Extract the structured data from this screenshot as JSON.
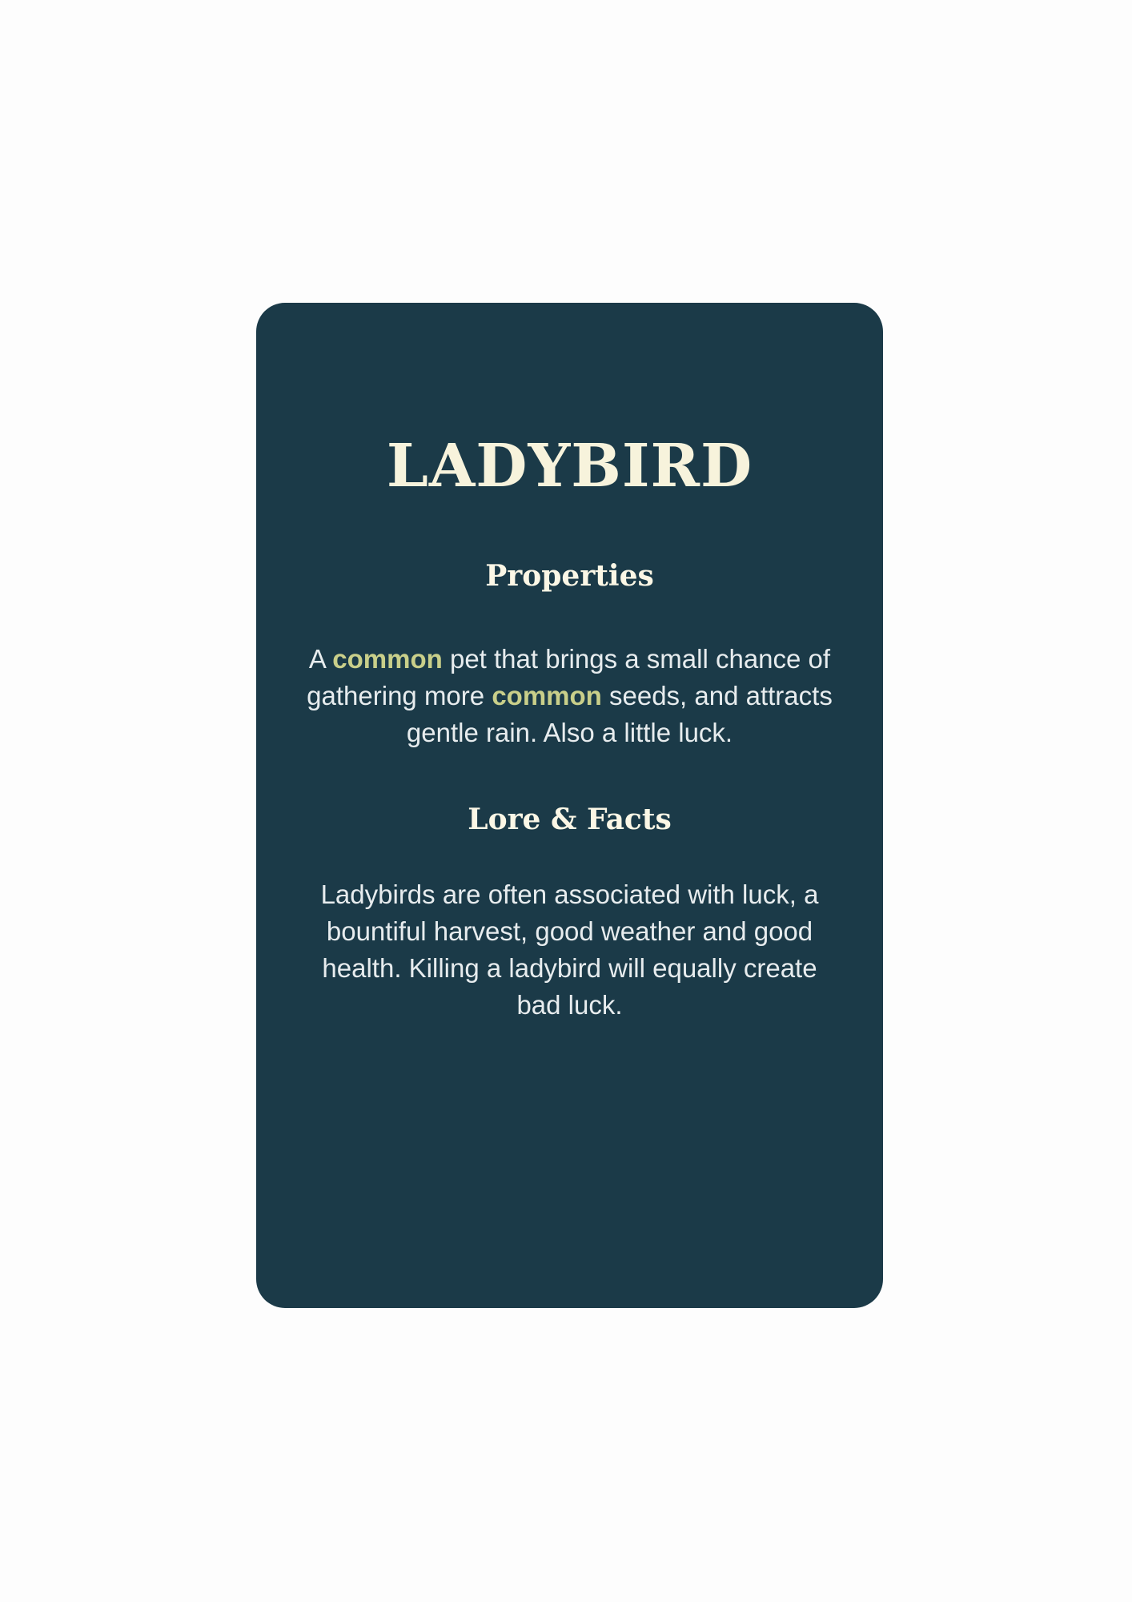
{
  "card": {
    "title": "LADYBIRD",
    "properties": {
      "heading": "Properties",
      "text_1": "A ",
      "highlight_1": "common",
      "text_2": " pet that brings a small chance of gathering more ",
      "highlight_2": "common",
      "text_3": " seeds, and attracts gentle rain. Also a little luck."
    },
    "lore": {
      "heading": "Lore & Facts",
      "text": "Ladybirds are often associated with luck, a bountiful harvest, good weather and good health. Killing a ladybird will equally create bad luck."
    }
  },
  "colors": {
    "page_background": "#fdfdfd",
    "card_background": "#1b3a48",
    "title_color": "#f7f3dc",
    "highlight_color": "#c9cf8a",
    "body_color": "#e7ecee"
  }
}
